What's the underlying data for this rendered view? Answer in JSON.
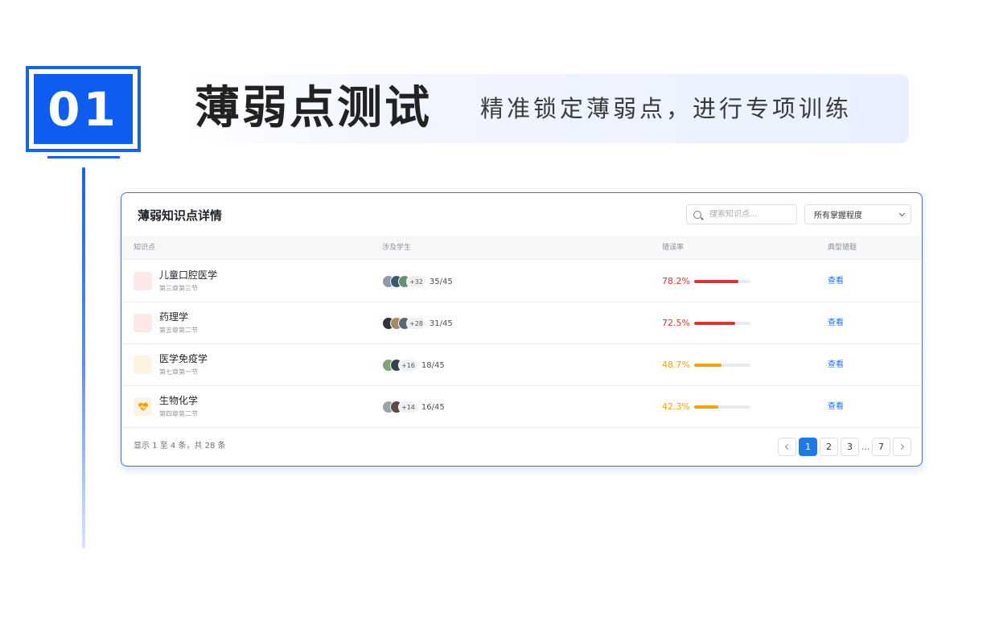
{
  "header": {
    "number": "01",
    "title": "薄弱点测试",
    "subtitle": "精准锁定薄弱点，进行专项训练"
  },
  "card": {
    "title": "薄弱知识点详情",
    "search_placeholder": "搜索知识点...",
    "filter_selected": "所有掌握程度",
    "columns": [
      "知识点",
      "涉及学生",
      "错误率",
      "典型错题"
    ],
    "rows": [
      {
        "name": "儿童口腔医学",
        "chapter": "第三章第三节",
        "more": "+32",
        "ratio": "35/45",
        "error_rate": "78.2%",
        "error_value": 78.2,
        "action": "查看",
        "level": "high",
        "icon_bg": "#fde8e8",
        "icon": ""
      },
      {
        "name": "药理学",
        "chapter": "第五章第二节",
        "more": "+28",
        "ratio": "31/45",
        "error_rate": "72.5%",
        "error_value": 72.5,
        "action": "查看",
        "level": "high",
        "icon_bg": "#fde8e8",
        "icon": ""
      },
      {
        "name": "医学免疫学",
        "chapter": "第七章第一节",
        "more": "+16",
        "ratio": "18/45",
        "error_rate": "48.7%",
        "error_value": 48.7,
        "action": "查看",
        "level": "mid",
        "icon_bg": "#fdf3e2",
        "icon": ""
      },
      {
        "name": "生物化学",
        "chapter": "第四章第二节",
        "more": "+14",
        "ratio": "16/45",
        "error_rate": "42.3%",
        "error_value": 42.3,
        "action": "查看",
        "level": "mid",
        "icon_bg": "#fdf3e2",
        "icon": "heartbeat-icon"
      }
    ],
    "footer": "显示 1 至 4 条，共 28 条",
    "pagination": {
      "pages": [
        "1",
        "2",
        "3"
      ],
      "ellipsis": "...",
      "last": "7",
      "current": "1"
    }
  },
  "colors": {
    "accent": "#1462f0",
    "error_high": "#e03131",
    "error_mid": "#f5a300",
    "link": "#1e6ee8"
  }
}
